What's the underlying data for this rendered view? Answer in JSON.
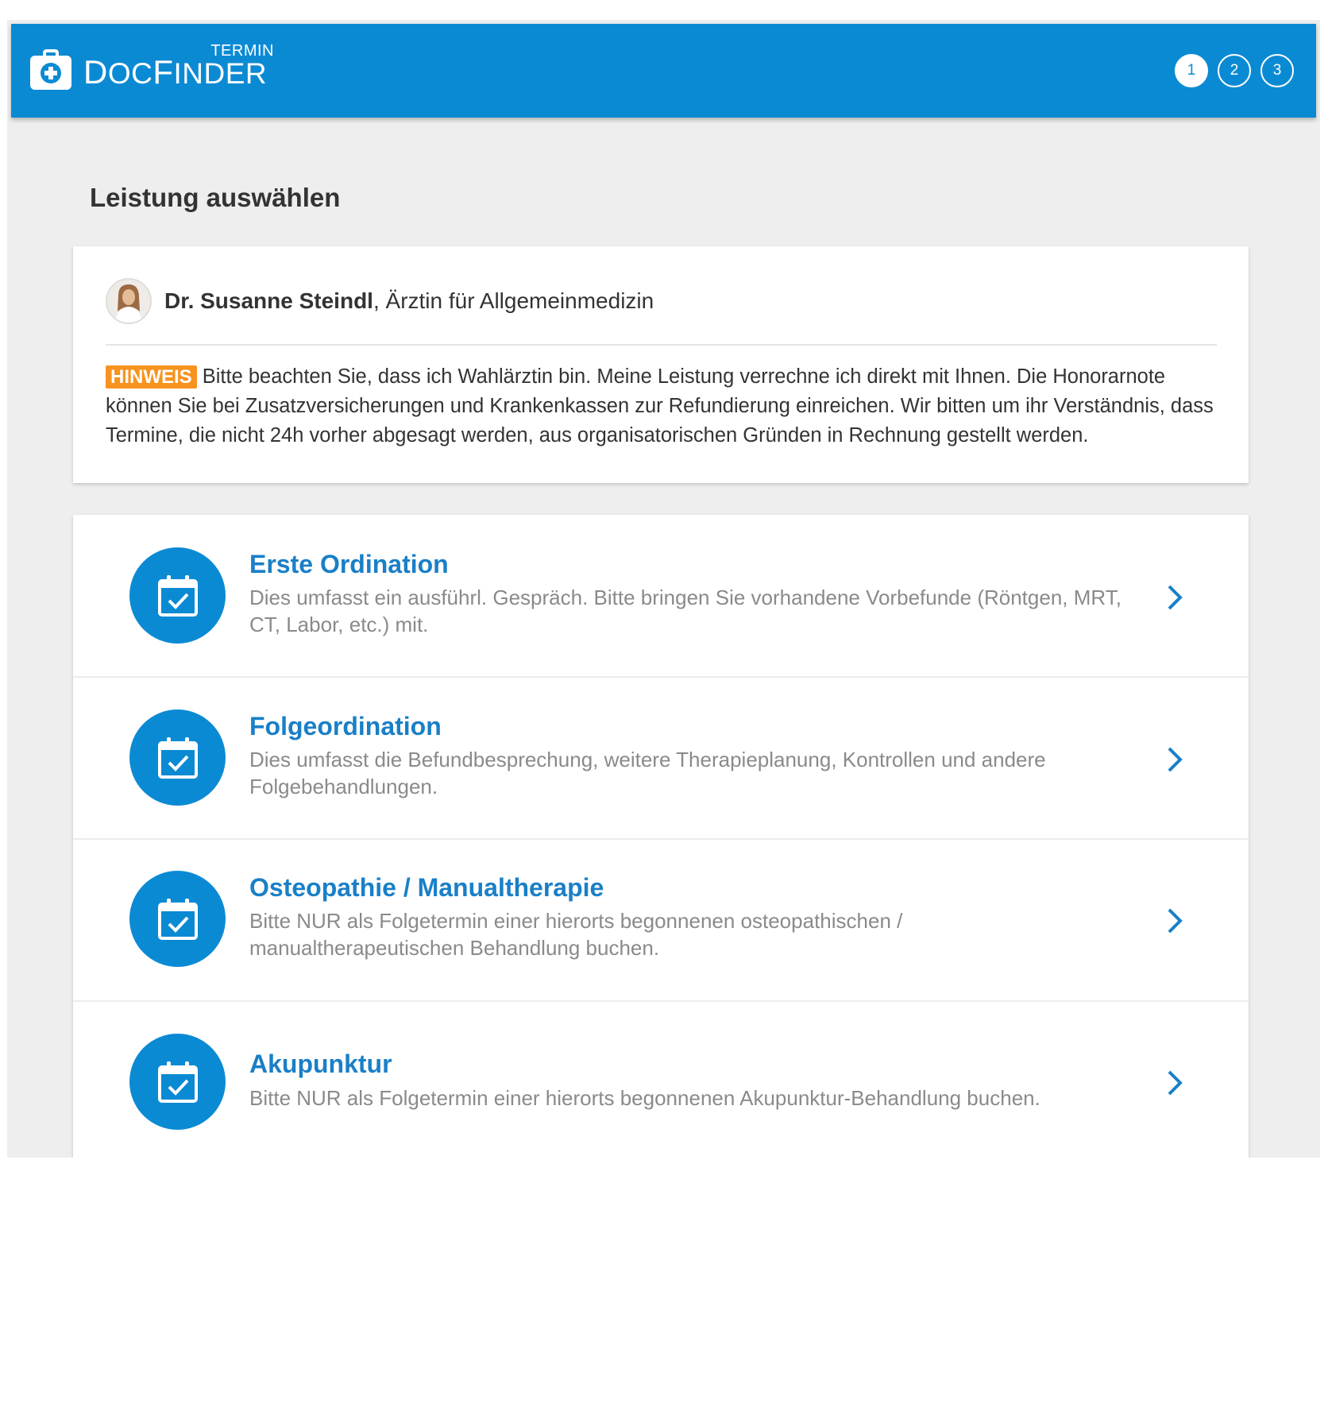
{
  "header": {
    "logo_termin": "TERMIN",
    "logo_brand_d": "D",
    "logo_brand_oc": "OC",
    "logo_brand_f": "F",
    "logo_brand_inder": "INDER",
    "steps": [
      "1",
      "2",
      "3"
    ],
    "active_step": "1",
    "brand_color": "#0b8ad4"
  },
  "page": {
    "title": "Leistung auswählen"
  },
  "doctor": {
    "name": "Dr. Susanne Steindl",
    "specialty": ", Ärztin für Allgemeinmedizin",
    "notice_badge": "HINWEIS",
    "notice_text": " Bitte beachten Sie, dass ich Wahlärztin bin. Meine Leistung verrechne ich direkt mit Ihnen. Die Honorarnote können Sie bei Zusatzversicherungen und Krankenkassen zur Refundierung einreichen. Wir bitten um ihr Verständnis, dass Termine, die nicht 24h vorher abgesagt werden, aus organisatorischen Gründen in Rechnung gestellt werden.",
    "badge_color": "#f7931e"
  },
  "services": [
    {
      "title": "Erste Ordination",
      "description": "Dies umfasst ein ausführl. Gespräch. Bitte bringen Sie vorhandene Vorbefunde (Röntgen, MRT, CT, Labor, etc.) mit.",
      "icon": "calendar-check-icon"
    },
    {
      "title": "Folgeordination",
      "description": "Dies umfasst die Befundbesprechung, weitere Therapieplanung, Kontrollen und andere Folgebehandlungen.",
      "icon": "calendar-check-icon"
    },
    {
      "title": "Osteopathie / Manualtherapie",
      "description": "Bitte NUR als Folgetermin einer hierorts begonnenen osteopathischen / manualtherapeutischen Behandlung buchen.",
      "icon": "calendar-check-icon"
    },
    {
      "title": "Akupunktur",
      "description": "Bitte NUR als Folgetermin einer hierorts begonnenen Akupunktur-Behandlung buchen.",
      "icon": "calendar-check-icon"
    }
  ]
}
